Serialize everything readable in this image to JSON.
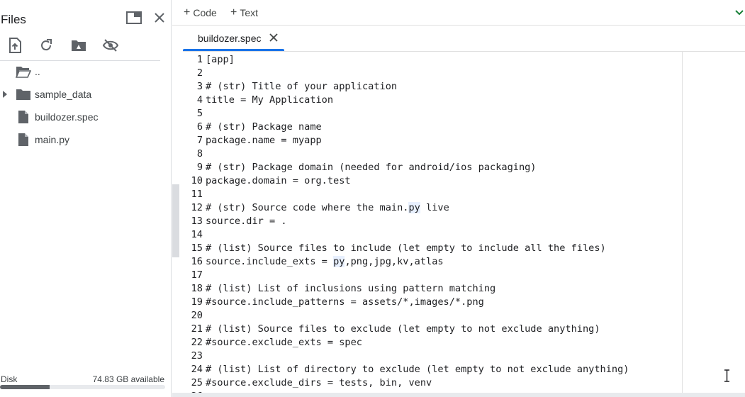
{
  "files_panel": {
    "title": "Files",
    "header_icons": [
      "open-in-window-icon",
      "close-icon"
    ],
    "toolbar_icons": [
      "upload-file-icon",
      "refresh-icon",
      "mount-drive-icon",
      "hide-files-icon"
    ],
    "items": [
      {
        "label": "..",
        "type": "parent-folder"
      },
      {
        "label": "sample_data",
        "type": "folder",
        "collapsed": true
      },
      {
        "label": "buildozer.spec",
        "type": "file"
      },
      {
        "label": "main.py",
        "type": "file"
      }
    ],
    "disk_label": "Disk",
    "disk_available": "74.83 GB available",
    "disk_used_fraction": 0.3
  },
  "topbar": {
    "add_code_label": "Code",
    "add_text_label": "Text"
  },
  "editor": {
    "tab_label": "buildozer.spec",
    "lines": [
      "[app]",
      "",
      "# (str) Title of your application",
      "title = My Application",
      "",
      "# (str) Package name",
      "package.name = myapp",
      "",
      "# (str) Package domain (needed for android/ios packaging)",
      "package.domain = org.test",
      "",
      "# (str) Source code where the main.py live",
      "source.dir = .",
      "",
      "# (list) Source files to include (let empty to include all the files)",
      "source.include_exts = py,png,jpg,kv,atlas",
      "",
      "# (list) List of inclusions using pattern matching",
      "#source.include_patterns = assets/*,images/*.png",
      "",
      "# (list) Source files to exclude (let empty to not exclude anything)",
      "#source.exclude_exts = spec",
      "",
      "# (list) List of directory to exclude (let empty to not exclude anything)",
      "#source.exclude_dirs = tests, bin, venv",
      ""
    ]
  },
  "colors": {
    "accent": "#1a73e8",
    "icon": "#5f6368",
    "word_highlight": "#e8f0fe"
  }
}
